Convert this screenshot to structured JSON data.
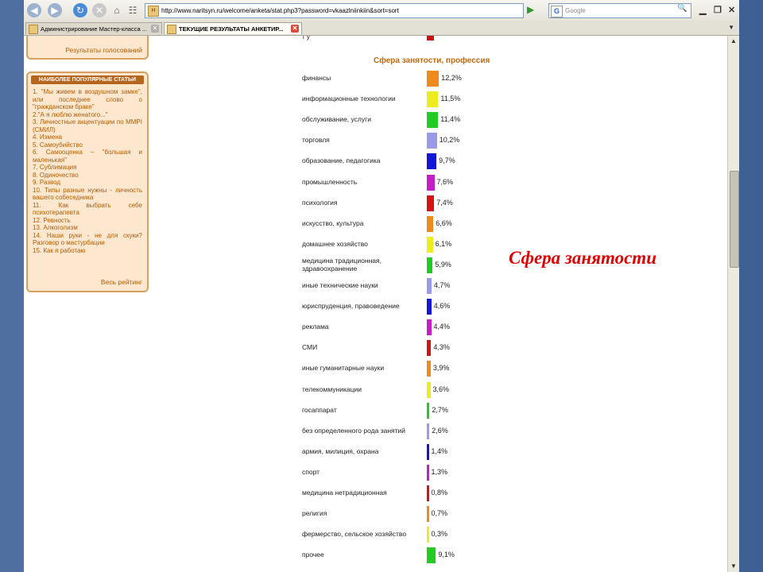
{
  "browser": {
    "url": "http://www.naritsyn.ru/welcome/anketa/stat.php3?password=vkaazlniinkiin&sort=sort",
    "search_placeholder": "Google",
    "search_engine_letter": "G",
    "favicon_letter": "Н"
  },
  "tabs": [
    {
      "label": "Администрирование Мастер-класса ...",
      "active": false
    },
    {
      "label": "ТЕКУЩИЕ РЕЗУЛЬТАТЫ АНКЕТИР...",
      "active": true
    }
  ],
  "sidebar": {
    "results_link": "Результаты голосований",
    "popular_header": "НАИБОЛЕЕ ПОПУЛЯРНЫЕ СТАТЬИ",
    "articles": [
      "1. \"Мы живем в воздушном замке\", или последнее слово о \"гражданском браке\"",
      "2.\"А я люблю женатого...\"",
      "3. Личностные акцентуации по MMPI (СМИЛ)",
      "4. Измена",
      "5. Самоубийство",
      "6. Самооценка – \"большая и маленькая\"",
      "7. Сублимация",
      "8. Одиночество",
      "9. Развод",
      "10. Типы разные нужны - личность вашего собеседника",
      "11. Как выбрать себе психотерапевта",
      "12. Ревность",
      "13. Алкоголизм",
      "14. Наши руки - не для скуки? Разговор о мастурбации",
      "15. Как я работаю"
    ],
    "rating_link": "Весь рейтинг"
  },
  "overlay_title": "Сфера занятости",
  "chart_data": {
    "type": "bar",
    "orientation": "horizontal",
    "title": "Сфера занятости, профессия",
    "categories": [
      "финансы",
      "информационные технологии",
      "обслуживание, услуги",
      "торговля",
      "образование, педагогика",
      "промышленность",
      "психология",
      "искусство, культура",
      "домашнее хозяйство",
      "медицина традиционная, здравоохранение",
      "иные технические науки",
      "юриспруденция, правоведение",
      "реклама",
      "СМИ",
      "иные гуманитарные науки",
      "телекоммуникации",
      "госаппарат",
      "без определенного рода занятий",
      "армия, милиция, охрана",
      "спорт",
      "медицина нетрадиционная",
      "религия",
      "фермерство, сельское хозяйство",
      "прочее"
    ],
    "values": [
      12.2,
      11.5,
      11.4,
      10.2,
      9.7,
      7.6,
      7.4,
      6.6,
      6.1,
      5.9,
      4.7,
      4.6,
      4.4,
      4.3,
      3.9,
      3.6,
      2.7,
      2.6,
      1.4,
      1.3,
      0.8,
      0.7,
      0.3,
      9.1
    ],
    "value_labels": [
      "12,2%",
      "11,5%",
      "11,4%",
      "10,2%",
      "9,7%",
      "7,6%",
      "7,4%",
      "6,6%",
      "6,1%",
      "5,9%",
      "4,7%",
      "4,6%",
      "4,4%",
      "4,3%",
      "3,9%",
      "3,6%",
      "2,7%",
      "2,6%",
      "1,4%",
      "1,3%",
      "0,8%",
      "0,7%",
      "0,3%",
      "9,1%"
    ],
    "colors": [
      "#ef8a1c",
      "#ecec20",
      "#22cc22",
      "#9a9ae8",
      "#1414d4",
      "#c61ec6",
      "#d41414",
      "#ef8a1c",
      "#ecec20",
      "#22cc22",
      "#9a9ae8",
      "#1414d4",
      "#c61ec6",
      "#d41414",
      "#ef8a1c",
      "#ecec20",
      "#22cc22",
      "#9a9ae8",
      "#1414d4",
      "#c61ec6",
      "#d41414",
      "#ef8a1c",
      "#ecec20",
      "#22cc22"
    ]
  }
}
